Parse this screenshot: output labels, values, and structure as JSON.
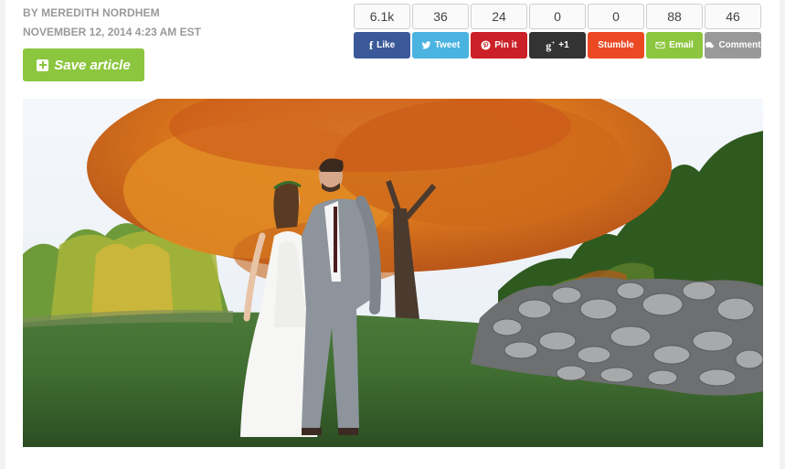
{
  "article": {
    "byline": "BY MEREDITH NORDHEM",
    "date": "NOVEMBER 12, 2014 4:23 AM EST",
    "save_label": "Save article"
  },
  "share": [
    {
      "count": "6.1k",
      "label": "Like",
      "icon": "facebook-icon",
      "color": "#3b5998"
    },
    {
      "count": "36",
      "label": "Tweet",
      "icon": "twitter-icon",
      "color": "#4ab3e0"
    },
    {
      "count": "24",
      "label": "Pin it",
      "icon": "pinterest-icon",
      "color": "#cb2027"
    },
    {
      "count": "0",
      "label": "+1",
      "icon": "google-plus-icon",
      "color": "#333333"
    },
    {
      "count": "0",
      "label": "Stumble",
      "icon": "stumbleupon-icon",
      "color": "#eb4924"
    },
    {
      "count": "88",
      "label": "Email",
      "icon": "envelope-icon",
      "color": "#8cc63f"
    },
    {
      "count": "46",
      "label": "Comment",
      "icon": "comment-icon",
      "color": "#999999"
    }
  ],
  "colors": {
    "accent_green": "#8cc63f",
    "meta_gray": "#9a9a9a"
  }
}
